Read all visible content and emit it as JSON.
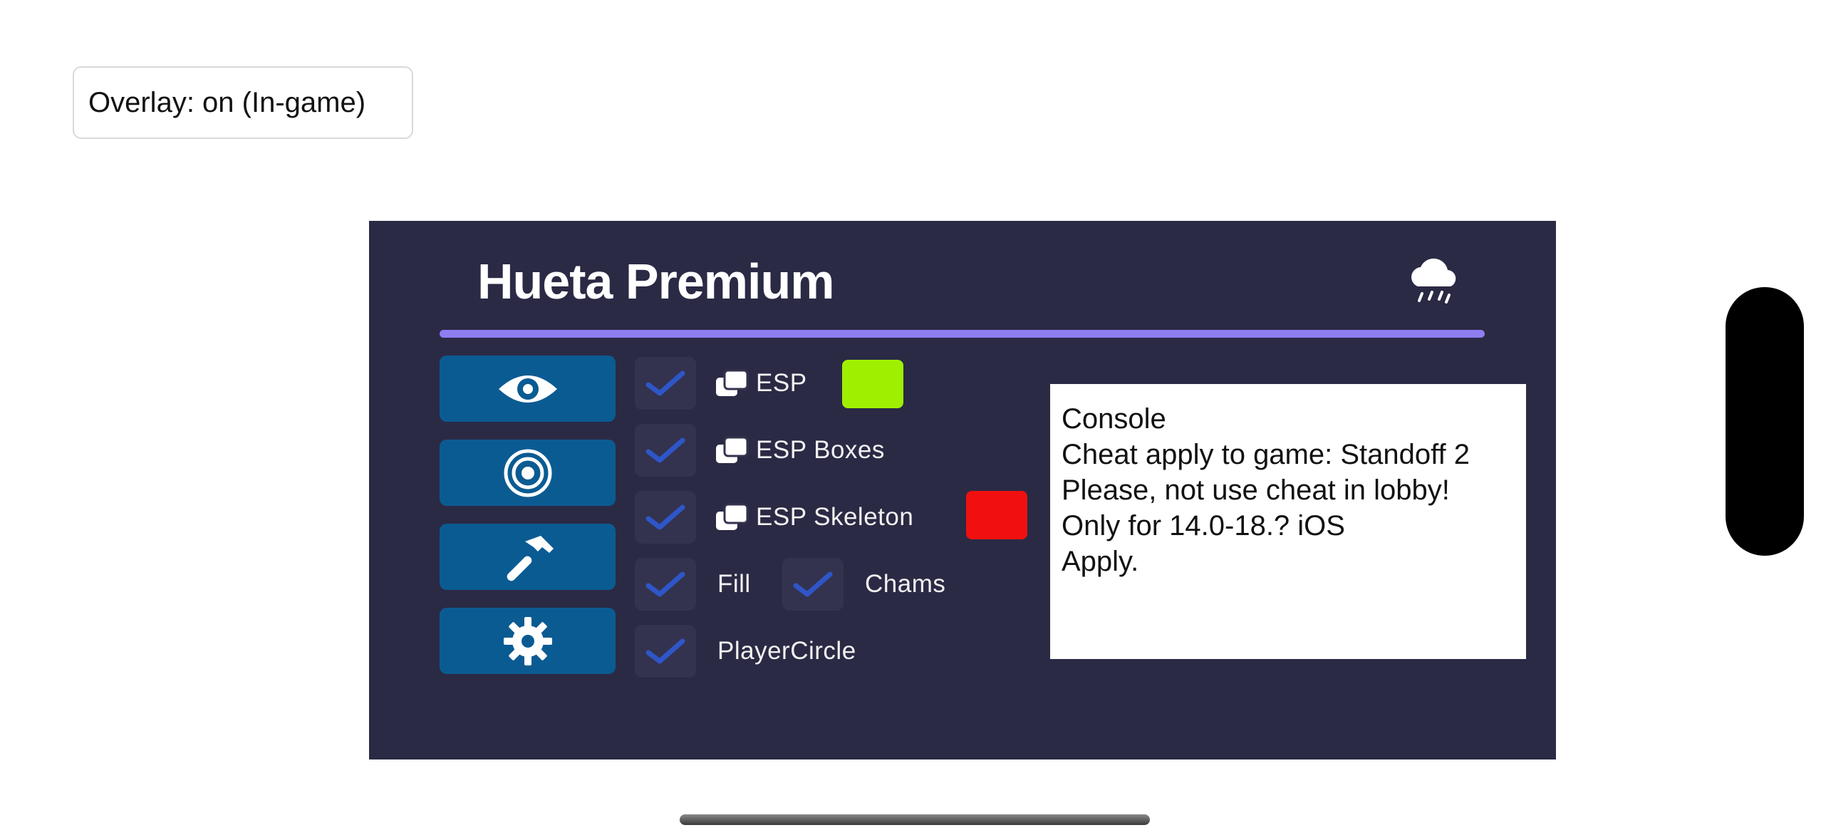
{
  "overlay_status": "Overlay: on (In-game)",
  "menu": {
    "title": "Hueta Premium",
    "accent_color": "#8f7df2",
    "background_color": "#2a2a45",
    "tab_button_color": "#0b5b93",
    "tabs": [
      {
        "icon": "eye-icon"
      },
      {
        "icon": "target-icon"
      },
      {
        "icon": "hammer-icon"
      },
      {
        "icon": "gear-icon"
      }
    ],
    "options": {
      "esp": {
        "label": "ESP",
        "checked": true,
        "color": "#9ef000"
      },
      "esp_boxes": {
        "label": "ESP Boxes",
        "checked": true
      },
      "esp_skeleton": {
        "label": "ESP Skeleton",
        "checked": true,
        "color": "#f01010"
      },
      "fill": {
        "label": "Fill",
        "checked": true
      },
      "chams": {
        "label": "Chams",
        "checked": true
      },
      "player_circle": {
        "label": "PlayerCircle",
        "checked": true
      }
    }
  },
  "console": {
    "lines": [
      "Console",
      "Cheat apply to game: Standoff 2",
      "Please, not use cheat in lobby!",
      "Only for 14.0-18.? iOS",
      "Apply."
    ]
  }
}
